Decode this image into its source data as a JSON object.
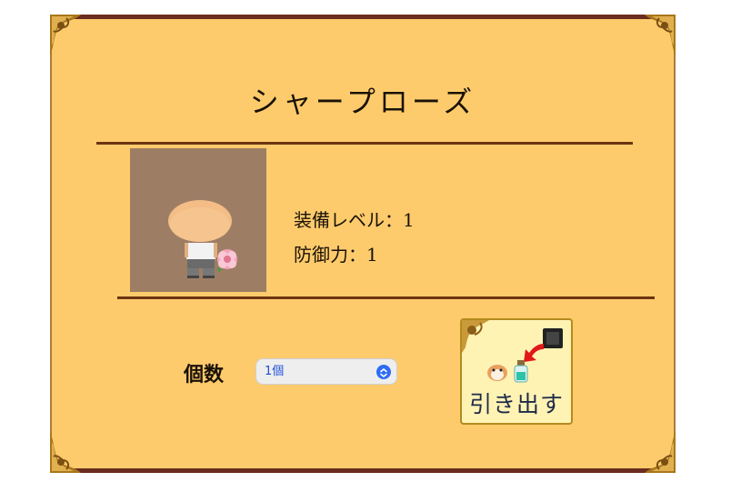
{
  "item": {
    "name": "シャープローズ",
    "stats": [
      {
        "label": "装備レベル",
        "separator": "：",
        "value": "1"
      },
      {
        "label": "防御力",
        "separator": "：",
        "value": "1"
      }
    ]
  },
  "quantity": {
    "label": "個数",
    "selected": "1個"
  },
  "withdraw_button": {
    "label": "引き出す"
  },
  "colors": {
    "panel_bg": "#fecb6c",
    "frame": "#6a2d20",
    "divider": "#6b3410",
    "portrait_bg": "#9d7e65",
    "button_bg": "#fff3b4"
  },
  "icons": [
    "ornate-corner-icon",
    "avatar-sprite",
    "rose-icon",
    "chevron-updown-icon",
    "storage-box-icon",
    "arrow-icon",
    "potion-icon",
    "hamster-icon"
  ]
}
